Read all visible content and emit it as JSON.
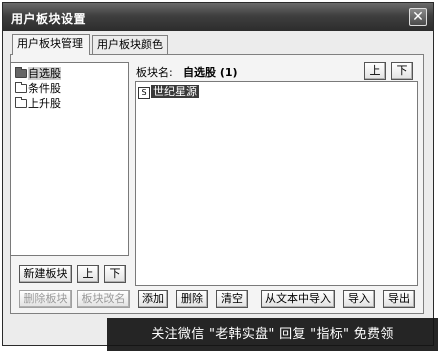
{
  "window": {
    "title": "用户板块设置",
    "close_glyph": "✕"
  },
  "tabs": [
    {
      "label": "用户板块管理",
      "active": true
    },
    {
      "label": "用户板块颜色",
      "active": false
    }
  ],
  "block_list": [
    {
      "label": "自选股",
      "selected": true
    },
    {
      "label": "条件股",
      "selected": false
    },
    {
      "label": "上升股",
      "selected": false
    }
  ],
  "left_buttons": {
    "new_block": "新建板块",
    "up": "上",
    "down": "下",
    "delete_block": "删除板块",
    "rename_block": "板块改名"
  },
  "block_info": {
    "label": "板块名:",
    "value": "自选股 (1)"
  },
  "stock_list": [
    {
      "icon": "S",
      "label": "世纪星源"
    }
  ],
  "right_buttons": {
    "up": "上",
    "down": "下",
    "add": "添加",
    "remove": "删除",
    "clear": "清空",
    "import_text": "从文本中导入",
    "import": "导入",
    "export": "导出"
  },
  "watermark": "关注微信 \"老韩实盘\" 回复 \"指标\" 免费领"
}
